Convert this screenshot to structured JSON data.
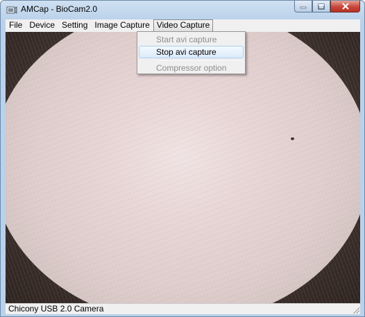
{
  "window": {
    "title": "AMCap - BioCam2.0",
    "accent_color": "#b9d1ea",
    "close_color": "#c8463a"
  },
  "menubar": {
    "items": [
      "File",
      "Device",
      "Setting",
      "Image Capture",
      "Video Capture"
    ],
    "open_menu": "Video Capture"
  },
  "dropdown": {
    "start_avi": {
      "label": "Start avi capture",
      "enabled": false
    },
    "stop_avi": {
      "label": "Stop avi capture",
      "enabled": true,
      "highlighted": true
    },
    "compressor": {
      "label": "Compressor option",
      "enabled": false
    }
  },
  "statusbar": {
    "text": "Chicony USB 2.0 Camera"
  },
  "icons": {
    "app": "camera-app-icon",
    "minimize": "minimize-icon",
    "maximize": "maximize-icon",
    "close": "close-icon",
    "grip": "resize-grip-icon"
  }
}
